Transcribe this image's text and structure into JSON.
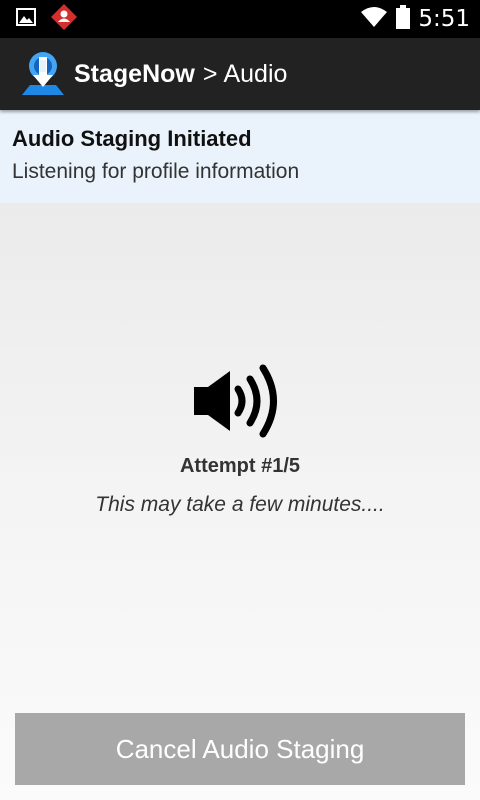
{
  "status_bar": {
    "time": "5:51",
    "icons": [
      "image-notification-icon",
      "app-notification-icon",
      "wifi-icon",
      "battery-icon"
    ]
  },
  "action_bar": {
    "app_name": "StageNow",
    "separator": ">",
    "section": "Audio",
    "background": "#222222"
  },
  "info": {
    "title": "Audio Staging Initiated",
    "subtitle": "Listening for profile information",
    "background": "#eaf3fb"
  },
  "main": {
    "icon": "speaker-icon",
    "attempt": "Attempt #1/5",
    "note": "This may take a few minutes...."
  },
  "cancel_button": {
    "label": "Cancel Audio Staging",
    "background": "#a8a8a8"
  }
}
